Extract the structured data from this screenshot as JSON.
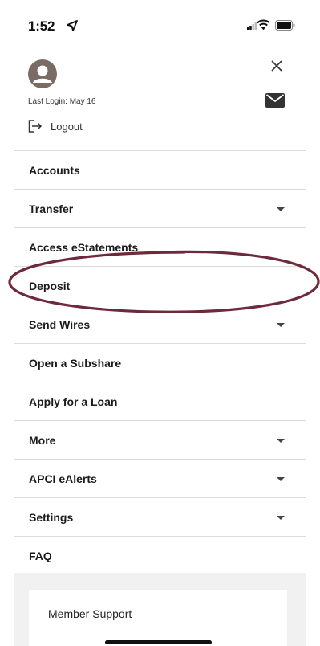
{
  "status_bar": {
    "time": "1:52",
    "icons": [
      "location-arrow-icon",
      "signal-icon",
      "wifi-icon",
      "battery-icon"
    ]
  },
  "header": {
    "last_login": "Last Login: May 16",
    "logout_label": "Logout",
    "icons": [
      "avatar-icon",
      "close-icon",
      "mail-icon",
      "logout-icon"
    ]
  },
  "menu": {
    "items": [
      {
        "label": "Accounts",
        "has_dropdown": false
      },
      {
        "label": "Transfer",
        "has_dropdown": true
      },
      {
        "label": "Access eStatements",
        "has_dropdown": false
      },
      {
        "label": "Deposit",
        "has_dropdown": false
      },
      {
        "label": "Send Wires",
        "has_dropdown": true
      },
      {
        "label": "Open a Subshare",
        "has_dropdown": false
      },
      {
        "label": "Apply for a Loan",
        "has_dropdown": false
      },
      {
        "label": "More",
        "has_dropdown": true
      },
      {
        "label": "APCI eAlerts",
        "has_dropdown": true
      },
      {
        "label": "Settings",
        "has_dropdown": true
      },
      {
        "label": "FAQ",
        "has_dropdown": false
      }
    ]
  },
  "footer": {
    "support_label": "Member Support"
  },
  "colors": {
    "avatar": "#7a6b64",
    "annotation": "#6e2a3a",
    "divider": "#dcdcdc",
    "footer_bg": "#f1f1f1"
  }
}
